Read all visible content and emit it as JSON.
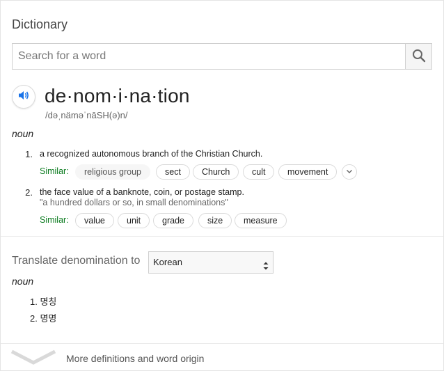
{
  "header": {
    "title": "Dictionary"
  },
  "search": {
    "placeholder": "Search for a word",
    "value": ""
  },
  "entry": {
    "word": "de·nom·i·na·tion",
    "phonetic": "/dəˌnäməˈnāSH(ə)n/",
    "part_of_speech": "noun",
    "definitions": [
      {
        "number": "1.",
        "text": "a recognized autonomous branch of the Christian Church.",
        "similar_label": "Similar:",
        "similar": [
          "religious group",
          "sect",
          "Church",
          "cult",
          "movement"
        ]
      },
      {
        "number": "2.",
        "text": "the face value of a banknote, coin, or postage stamp.",
        "example": "\"a hundred dollars or so, in small denominations\"",
        "similar_label": "Similar:",
        "similar": [
          "value",
          "unit",
          "grade",
          "size",
          "measure"
        ]
      }
    ]
  },
  "translate": {
    "label": "Translate denomination to",
    "language": "Korean",
    "part_of_speech": "noun",
    "items": [
      {
        "number": "1.",
        "text": "명칭"
      },
      {
        "number": "2.",
        "text": "명명"
      }
    ]
  },
  "footer": {
    "more_label": "More definitions and word origin"
  },
  "icons": {
    "speaker": "speaker-icon",
    "search": "search-icon",
    "expand": "chevron-down-icon"
  },
  "colors": {
    "accent": "#1a73e8",
    "similar_green": "#0b7b1f"
  }
}
